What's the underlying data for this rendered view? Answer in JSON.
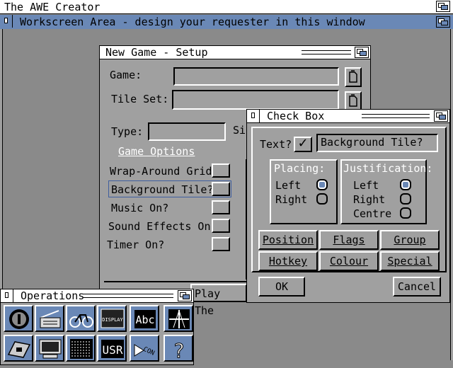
{
  "screen": {
    "title": "The AWE Creator"
  },
  "workscreen": {
    "title": "Workscreen Area - design your requester in this window"
  },
  "setup": {
    "title": "New Game - Setup",
    "game_label": "Game:",
    "game_value": "",
    "tileset_label": "Tile Set:",
    "tileset_value": "",
    "type_label": "Type:",
    "type_value": "",
    "size_label_partial": "Si",
    "game_options_link": "Game Options",
    "options": [
      {
        "label": "Wrap-Around Grid?"
      },
      {
        "label": "Background Tile?"
      },
      {
        "label": "Music On?"
      },
      {
        "label": "Sound Effects On?"
      },
      {
        "label": "Timer On?"
      }
    ],
    "play_partial": "Play The"
  },
  "checkbox": {
    "title": "Check Box",
    "text_label": "Text?",
    "check_mark": "✓",
    "text_value": "Background Tile?",
    "placing": {
      "title": "Placing:",
      "left": "Left",
      "right": "Right",
      "selected": "Left"
    },
    "justification": {
      "title": "Justification:",
      "left": "Left",
      "right": "Right",
      "centre": "Centre",
      "selected": "Left"
    },
    "buttons": {
      "position": "Position",
      "flags": "Flags",
      "group": "Group",
      "hotkey": "Hotkey",
      "colour": "Colour",
      "special": "Special",
      "ok": "OK",
      "cancel": "Cancel"
    }
  },
  "operations": {
    "title": "Operations",
    "tools": [
      {
        "icon": "info-icon"
      },
      {
        "icon": "radio-icon"
      },
      {
        "icon": "bicycle-icon"
      },
      {
        "icon": "display-icon",
        "text": "DISPLAY"
      },
      {
        "icon": "text-icon",
        "text": "Abc"
      },
      {
        "icon": "crosshair-icon"
      },
      {
        "icon": "keyboard-icon"
      },
      {
        "icon": "monitor-icon"
      },
      {
        "icon": "pattern-icon"
      },
      {
        "icon": "user-icon",
        "text": "USR"
      },
      {
        "icon": "connect-icon",
        "text": "CON"
      },
      {
        "icon": "help-icon",
        "text": "?"
      }
    ]
  },
  "colors": {
    "blue": "#6a88b6",
    "grey": "#a0a0a0",
    "desktop": "#8a8a8a"
  }
}
